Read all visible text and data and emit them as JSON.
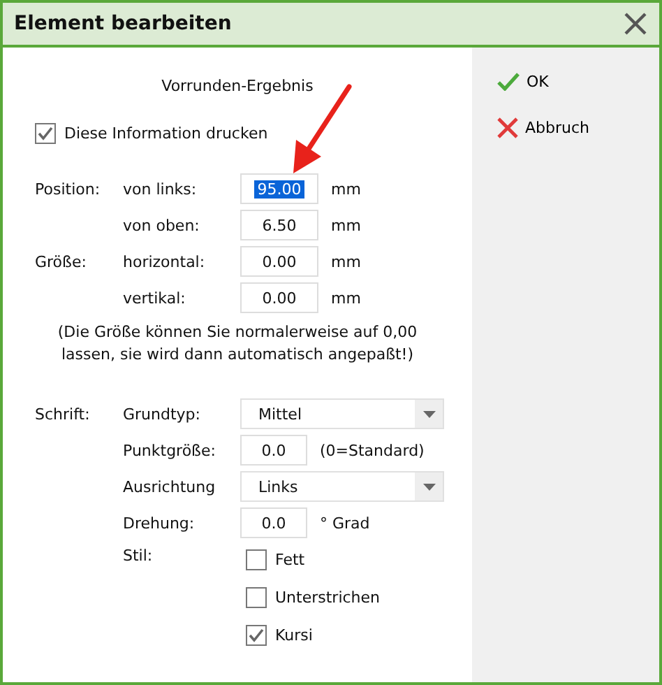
{
  "window": {
    "title": "Element bearbeiten"
  },
  "heading": "Vorrunden-Ergebnis",
  "print_option": {
    "label": "Diese Information drucken",
    "checked": true
  },
  "position_rows": [
    {
      "group": "Position:",
      "label": "von links:",
      "value": "95.00",
      "unit": "mm",
      "selected": true
    },
    {
      "label": "von oben:",
      "value": "6.50",
      "unit": "mm",
      "selected": false
    },
    {
      "group": "Größe:",
      "label": "horizontal:",
      "value": "0.00",
      "unit": "mm",
      "selected": false
    },
    {
      "label": "vertikal:",
      "value": "0.00",
      "unit": "mm",
      "selected": false
    }
  ],
  "note": "(Die Größe können Sie normalerweise auf 0,00\nlassen, sie wird dann automatisch angepaßt!)",
  "font_rows": [
    {
      "group": "Schrift:",
      "label": "Grundtyp:",
      "kind": "dropdown",
      "value": "Mittel"
    },
    {
      "label": "Punktgröße:",
      "kind": "input",
      "value": "0.0",
      "unit": "(0=Standard)"
    },
    {
      "label": "Ausrichtung",
      "kind": "dropdown",
      "value": "Links"
    },
    {
      "label": "Drehung:",
      "kind": "input",
      "value": "0.0",
      "unit": "° Grad"
    },
    {
      "label": "Stil:",
      "kind": "checkboxes",
      "options": [
        {
          "label": "Fett",
          "checked": false
        },
        {
          "label": "Unterstrichen",
          "checked": false
        },
        {
          "label": "Kursi",
          "checked": true
        }
      ]
    }
  ],
  "buttons": [
    {
      "label": "OK",
      "kind": "ok"
    },
    {
      "label": "Abbruch",
      "kind": "cancel"
    }
  ]
}
